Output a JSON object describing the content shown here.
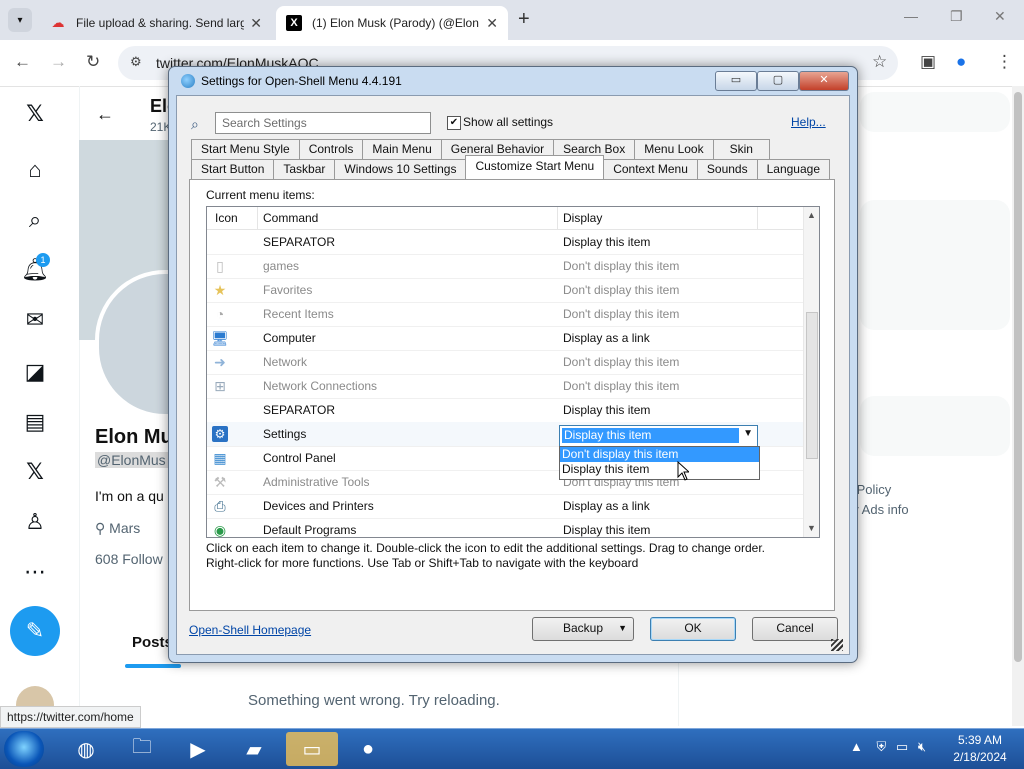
{
  "browser": {
    "tabs": [
      {
        "title": "File upload & sharing. Send larg",
        "icon": "cloud-icon"
      },
      {
        "title": "(1) Elon Musk (Parody) (@Elon",
        "icon": "x-logo-icon"
      }
    ],
    "url": "twitter.com/ElonMuskAOC",
    "status_url": "https://twitter.com/home"
  },
  "twitter": {
    "notification_count": "1",
    "name": "Elon Mu",
    "header_name": "Elo",
    "header_posts": "21K",
    "handle": "@ElonMus",
    "bio": "I'm on a qu",
    "location": "Mars",
    "followers": "608 Follow",
    "posts_tab": "Posts",
    "error": "Something went wrong. Try reloading.",
    "right_links": [
      "cy Policy",
      "ility  Ads info",
      "."
    ]
  },
  "dialog": {
    "title": "Settings for Open-Shell Menu 4.4.191",
    "search_placeholder": "Search Settings",
    "show_all_label": "Show all settings",
    "show_all_checked": true,
    "help_link": "Help...",
    "tabs_row1": [
      "Start Menu Style",
      "Controls",
      "Main Menu",
      "General Behavior",
      "Search Box",
      "Menu Look",
      "Skin"
    ],
    "tabs_row2": [
      "Start Button",
      "Taskbar",
      "Windows 10 Settings",
      "Customize Start Menu",
      "Context Menu",
      "Sounds",
      "Language"
    ],
    "selected_tab": "Customize Start Menu",
    "current_items_label": "Current menu items:",
    "columns": {
      "icon": "Icon",
      "command": "Command",
      "display": "Display"
    },
    "rows": [
      {
        "command": "SEPARATOR",
        "display": "Display this item",
        "icon": "",
        "dim": false
      },
      {
        "command": "games",
        "display": "Don't display this item",
        "icon": "page-icon",
        "dim": true
      },
      {
        "command": "Favorites",
        "display": "Don't display this item",
        "icon": "star-icon",
        "dim": true
      },
      {
        "command": "Recent Items",
        "display": "Don't display this item",
        "icon": "recent-icon",
        "dim": true
      },
      {
        "command": "Computer",
        "display": "Display as a link",
        "icon": "computer-icon",
        "dim": false
      },
      {
        "command": "Network",
        "display": "Don't display this item",
        "icon": "network-icon",
        "dim": true
      },
      {
        "command": "Network Connections",
        "display": "Don't display this item",
        "icon": "network-connections-icon",
        "dim": true
      },
      {
        "command": "SEPARATOR",
        "display": "Display this item",
        "icon": "",
        "dim": false
      },
      {
        "command": "Settings",
        "display": "Display this item",
        "icon": "settings-gear-icon",
        "dim": false
      },
      {
        "command": "Control Panel",
        "display": "",
        "icon": "control-panel-icon",
        "dim": false
      },
      {
        "command": "Administrative Tools",
        "display": "Don't display this item",
        "icon": "admin-tools-icon",
        "dim": true
      },
      {
        "command": "Devices and Printers",
        "display": "Display as a link",
        "icon": "printer-icon",
        "dim": false
      },
      {
        "command": "Default Programs",
        "display": "Display this item",
        "icon": "default-programs-icon",
        "dim": false
      }
    ],
    "combo_value": "Display this item",
    "dropdown_options": [
      "Don't display this item",
      "Display this item"
    ],
    "dropdown_highlighted": "Don't display this item",
    "hint_line1": "Click on each item to change it. Double-click the icon to edit the additional settings. Drag to change order.",
    "hint_line2": "Right-click for more functions. Use Tab or Shift+Tab to navigate with the keyboard",
    "homepage_link": "Open-Shell Homepage",
    "backup_label": "Backup",
    "ok_label": "OK",
    "cancel_label": "Cancel"
  },
  "taskbar": {
    "time": "5:39 AM",
    "date": "2/18/2024"
  }
}
